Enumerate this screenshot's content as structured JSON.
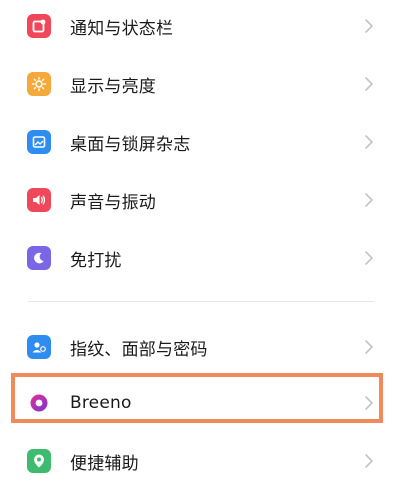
{
  "settings_list": {
    "group1": [
      {
        "label": "通知与状态栏",
        "icon": "notification-icon",
        "color": "#f0485a"
      },
      {
        "label": "显示与亮度",
        "icon": "brightness-icon",
        "color": "#f6a93b"
      },
      {
        "label": "桌面与锁屏杂志",
        "icon": "wallpaper-icon",
        "color": "#2f8cf0"
      },
      {
        "label": "声音与振动",
        "icon": "speaker-icon",
        "color": "#f0485a"
      },
      {
        "label": "免打扰",
        "icon": "moon-icon",
        "color": "#7b66e8"
      }
    ],
    "group2": [
      {
        "label": "指纹、面部与密码",
        "icon": "fingerprint-user-icon",
        "color": "#2f8cf0"
      },
      {
        "label": "Breeno",
        "icon": "breeno-icon",
        "color": "#c02fb0"
      },
      {
        "label": "便捷辅助",
        "icon": "assist-icon",
        "color": "#3dbb6e"
      }
    ]
  },
  "highlighted_item": "Breeno",
  "highlight_color": "#f08a5d"
}
